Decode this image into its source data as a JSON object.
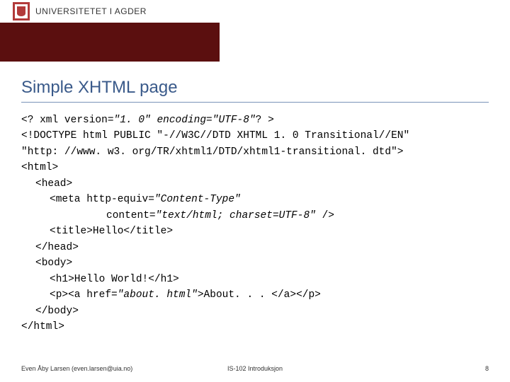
{
  "header": {
    "university_name": "UNIVERSITETET I AGDER",
    "logo_alt": "uia-logo"
  },
  "slide": {
    "title": "Simple XHTML page",
    "code": {
      "l1a": "<? xml version=",
      "l1b": "\"1. 0\" encoding=\"UTF-8\"",
      "l1c": "? >",
      "l2": "<!DOCTYPE html PUBLIC \"-//W3C//DTD XHTML 1. 0 Transitional//EN\"",
      "l3": "\"http: //www. w3. org/TR/xhtml1/DTD/xhtml1-transitional. dtd\">",
      "l4": "<html>",
      "l5": "<head>",
      "l6a": "<meta http-equiv=",
      "l6b": "\"Content-Type\"",
      "l7a": "content=",
      "l7b": "\"text/html; charset=UTF-8\"",
      "l7c": " />",
      "l8": "<title>Hello</title>",
      "l9": "</head>",
      "l10": "<body>",
      "l11": "<h1>Hello World!</h1>",
      "l12a": "<p><a href=",
      "l12b": "\"about. html\"",
      "l12c": ">About. . . </a></p>",
      "l13": "</body>",
      "l14": "</html>"
    }
  },
  "footer": {
    "author": "Even Åby Larsen (even.larsen@uia.no)",
    "course": "IS-102 Introduksjon",
    "page": "8"
  }
}
